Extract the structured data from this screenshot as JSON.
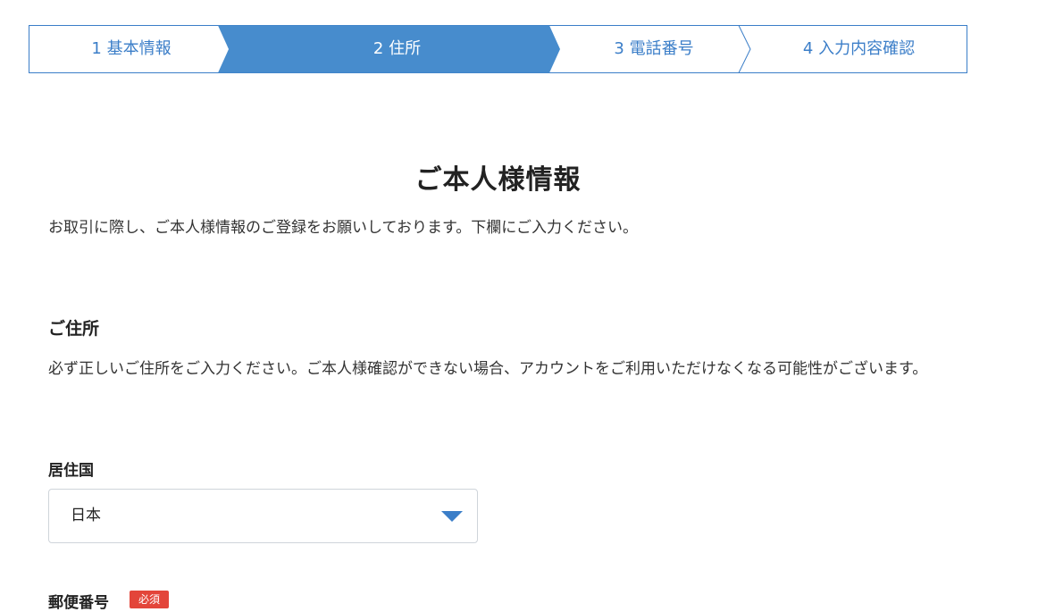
{
  "colors": {
    "accent": "#3b7ec8",
    "required": "#e3453a"
  },
  "stepper": {
    "steps": [
      {
        "label": "1 基本情報",
        "active": false
      },
      {
        "label": "2 住所",
        "active": true
      },
      {
        "label": "3 電話番号",
        "active": false
      },
      {
        "label": "4 入力内容確認",
        "active": false
      }
    ]
  },
  "page": {
    "title": "ご本人様情報",
    "intro": "お取引に際し、ご本人様情報のご登録をお願いしております。下欄にご入力ください。"
  },
  "address_section": {
    "title": "ご住所",
    "description": "必ず正しいご住所をご入力ください。ご本人様確認ができない場合、アカウントをご利用いただけなくなる可能性がございます。"
  },
  "country_field": {
    "label": "居住国",
    "selected_value": "日本",
    "icon": "chevron-down-icon"
  },
  "postal_field": {
    "label": "郵便番号",
    "required_badge": "必須"
  }
}
